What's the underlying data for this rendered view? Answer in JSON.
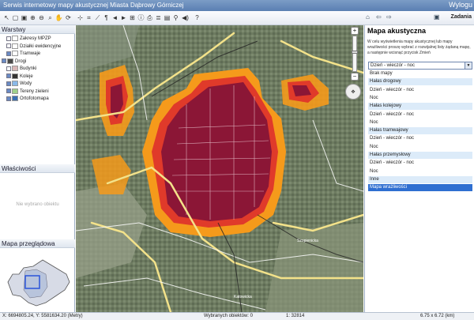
{
  "header": {
    "title": "Serwis internetowy mapy akustycznej Miasta Dąbrowy Górniczej",
    "logout": "Wylogu"
  },
  "toolbar": {
    "tasks_label": "Zadania",
    "buttons": [
      "arrow-icon",
      "select-icon",
      "select-box-icon",
      "zoom-in-icon",
      "zoom-out-icon",
      "zoom-window-icon",
      "pan-icon",
      "refresh-icon",
      "measure-icon",
      "area-icon",
      "polyline-icon",
      "text-icon",
      "prev-view-icon",
      "next-view-icon",
      "full-extent-icon",
      "info-icon",
      "print-icon",
      "layers-icon",
      "legend-icon",
      "link-icon",
      "sound-icon",
      "help-icon"
    ]
  },
  "layers_panel": {
    "title": "Warstwy",
    "items": [
      {
        "label": "Zakresy MPZP",
        "checked": false,
        "swatch": "#ffffff"
      },
      {
        "label": "Działki ewidencyjne",
        "checked": false,
        "swatch": "#ffffff"
      },
      {
        "label": "Tramwaje",
        "checked": true,
        "swatch": "#ffffff"
      },
      {
        "label": "Drogi",
        "checked": true,
        "swatch": "#4a4a4a"
      },
      {
        "label": "Budynki",
        "checked": false,
        "swatch": "#d9b7b7"
      },
      {
        "label": "Koleje",
        "checked": true,
        "swatch": "#333333"
      },
      {
        "label": "Wody",
        "checked": true,
        "swatch": "#8ab8e8"
      },
      {
        "label": "Tereny zieleni",
        "checked": true,
        "swatch": "#9fd08a"
      },
      {
        "label": "Ortofotomapa",
        "checked": true,
        "swatch": "#3a6fb3"
      }
    ]
  },
  "properties_panel": {
    "title": "Właściwości",
    "empty": "Nie wybrano obiektu"
  },
  "overview_panel": {
    "title": "Mapa przeglądowa"
  },
  "right_panel": {
    "title": "Mapa akustyczna",
    "description": "W celu wyświetlenia mapy akustycznej lub mapy wrażliwości proszę wybrać z rozwijalnej listy żądaną mapę, a następnie wcisnąć przycisk Zmień",
    "select_value": "Dzień - wieczór - noc",
    "options": [
      {
        "label": "Brak mapy",
        "kind": "item"
      },
      {
        "label": "Hałas drogowy",
        "kind": "group"
      },
      {
        "label": "Dzień - wieczór - noc",
        "kind": "item"
      },
      {
        "label": "Noc",
        "kind": "item"
      },
      {
        "label": "Hałas kolejowy",
        "kind": "group"
      },
      {
        "label": "Dzień - wieczór - noc",
        "kind": "item"
      },
      {
        "label": "Noc",
        "kind": "item"
      },
      {
        "label": "Hałas tramwajowy",
        "kind": "group"
      },
      {
        "label": "Dzień - wieczór - noc",
        "kind": "item"
      },
      {
        "label": "Noc",
        "kind": "item"
      },
      {
        "label": "Hałas przemysłowy",
        "kind": "group"
      },
      {
        "label": "Dzień - wieczór - noc",
        "kind": "item"
      },
      {
        "label": "Noc",
        "kind": "item"
      },
      {
        "label": "Inne",
        "kind": "group"
      },
      {
        "label": "Mapa wrażliwości",
        "kind": "selected"
      }
    ]
  },
  "status_bar": {
    "coords": "X: 6694805.24, Y: 5581634.20 (Metry)",
    "selected": "Wybranych obiektów: 0",
    "scale": "1: 32814",
    "size": "6.75 x 6.72 (km)"
  },
  "colors": {
    "header": "#5a7fb2",
    "noise_high": "#8b1a3a",
    "noise_mid": "#e0422b",
    "noise_low": "#f7a000",
    "selected": "#2f6fd1"
  }
}
